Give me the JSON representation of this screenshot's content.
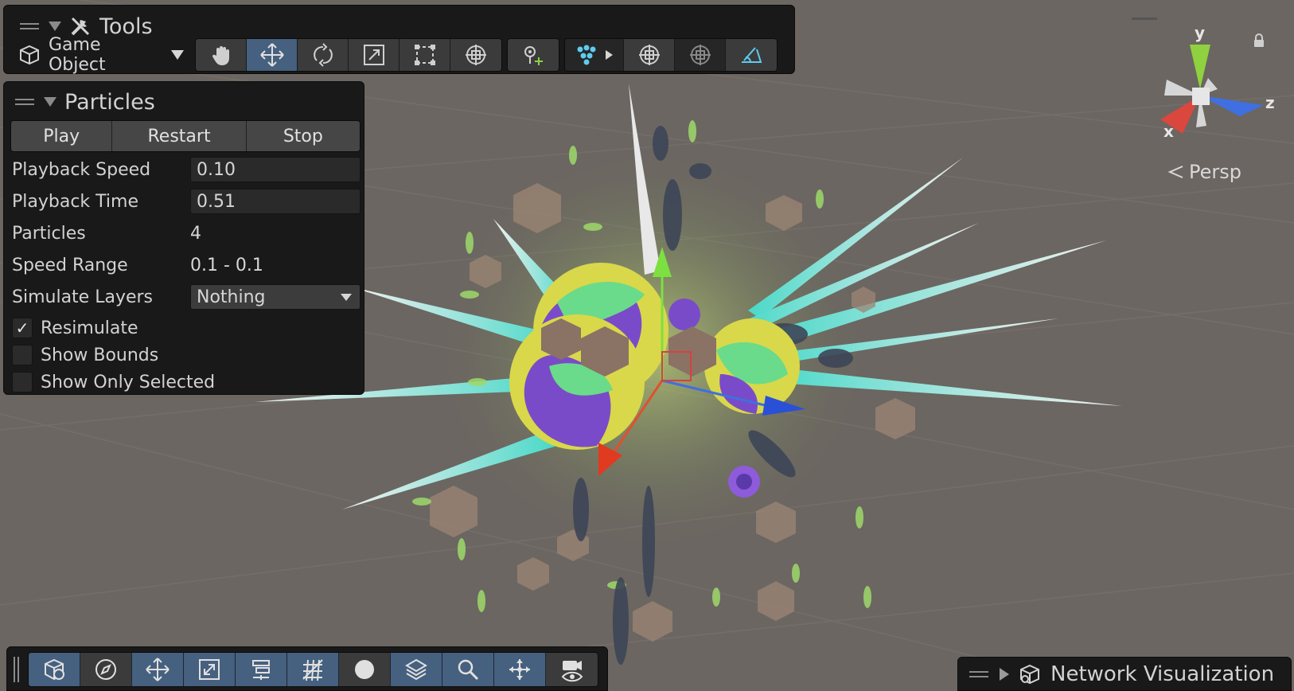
{
  "tools_panel": {
    "title": "Tools",
    "game_object_label": "Game Object",
    "transform_tools": [
      {
        "name": "hand-tool",
        "icon": "hand-icon",
        "active": false
      },
      {
        "name": "move-tool",
        "icon": "move-icon",
        "active": true
      },
      {
        "name": "rotate-tool",
        "icon": "rotate-icon",
        "active": false
      },
      {
        "name": "scale-tool",
        "icon": "scale-icon",
        "active": false
      },
      {
        "name": "rect-tool",
        "icon": "rect-icon",
        "active": false
      },
      {
        "name": "transform-tool",
        "icon": "transform-icon",
        "active": false
      }
    ],
    "custom_tool": {
      "name": "custom-editor-tool",
      "icon": "pivot-plus-icon"
    },
    "component_tools": [
      {
        "name": "particle-tool",
        "icon": "particle-system-icon",
        "active": true
      },
      {
        "name": "shape-tool",
        "icon": "shape-gizmo-icon",
        "active": false
      },
      {
        "name": "bounds-tool",
        "icon": "bounds-gizmo-icon",
        "active": false
      },
      {
        "name": "collision-tool",
        "icon": "collision-plane-icon",
        "active": false
      }
    ]
  },
  "particles_panel": {
    "title": "Particles",
    "buttons": {
      "play": "Play",
      "restart": "Restart",
      "stop": "Stop"
    },
    "playback_speed": {
      "label": "Playback Speed",
      "value": "0.10"
    },
    "playback_time": {
      "label": "Playback Time",
      "value": "0.51"
    },
    "particles": {
      "label": "Particles",
      "value": "4"
    },
    "speed_range": {
      "label": "Speed Range",
      "value": "0.1 - 0.1"
    },
    "simulate_layers": {
      "label": "Simulate Layers",
      "value": "Nothing"
    },
    "resimulate": {
      "label": "Resimulate",
      "checked": true
    },
    "show_bounds": {
      "label": "Show Bounds",
      "checked": false
    },
    "show_only_selected": {
      "label": "Show Only Selected",
      "checked": false
    }
  },
  "scene_gizmo": {
    "axes": {
      "x": "x",
      "y": "y",
      "z": "z"
    },
    "projection_label": "Persp",
    "colors": {
      "x": "#d9473f",
      "y": "#8fd13f",
      "z": "#3f6fe0"
    }
  },
  "bottom_toolbar": {
    "buttons": [
      {
        "name": "draw-mode",
        "icon": "scene-shading-icon",
        "active": true
      },
      {
        "name": "scene-view-2d",
        "icon": "compass-icon",
        "active": false
      },
      {
        "name": "snap-move",
        "icon": "move-snap-icon",
        "active": true
      },
      {
        "name": "effects",
        "icon": "scene-effects-icon",
        "active": true
      },
      {
        "name": "alignment",
        "icon": "align-icon",
        "active": true
      },
      {
        "name": "grid",
        "icon": "grid-icon",
        "active": true
      },
      {
        "name": "lighting",
        "icon": "sphere-icon",
        "active": false
      },
      {
        "name": "layers",
        "icon": "layers-icon",
        "active": true
      },
      {
        "name": "search",
        "icon": "search-icon",
        "active": true
      },
      {
        "name": "orientation",
        "icon": "orientation-icon",
        "active": true
      },
      {
        "name": "camera",
        "icon": "camera-visibility-icon",
        "active": true
      }
    ]
  },
  "network_visualization": {
    "label": "Network Visualization"
  },
  "colors": {
    "panel_bg": "#191919",
    "active_button": "#46607f",
    "scene_bg": "#6b6661"
  }
}
